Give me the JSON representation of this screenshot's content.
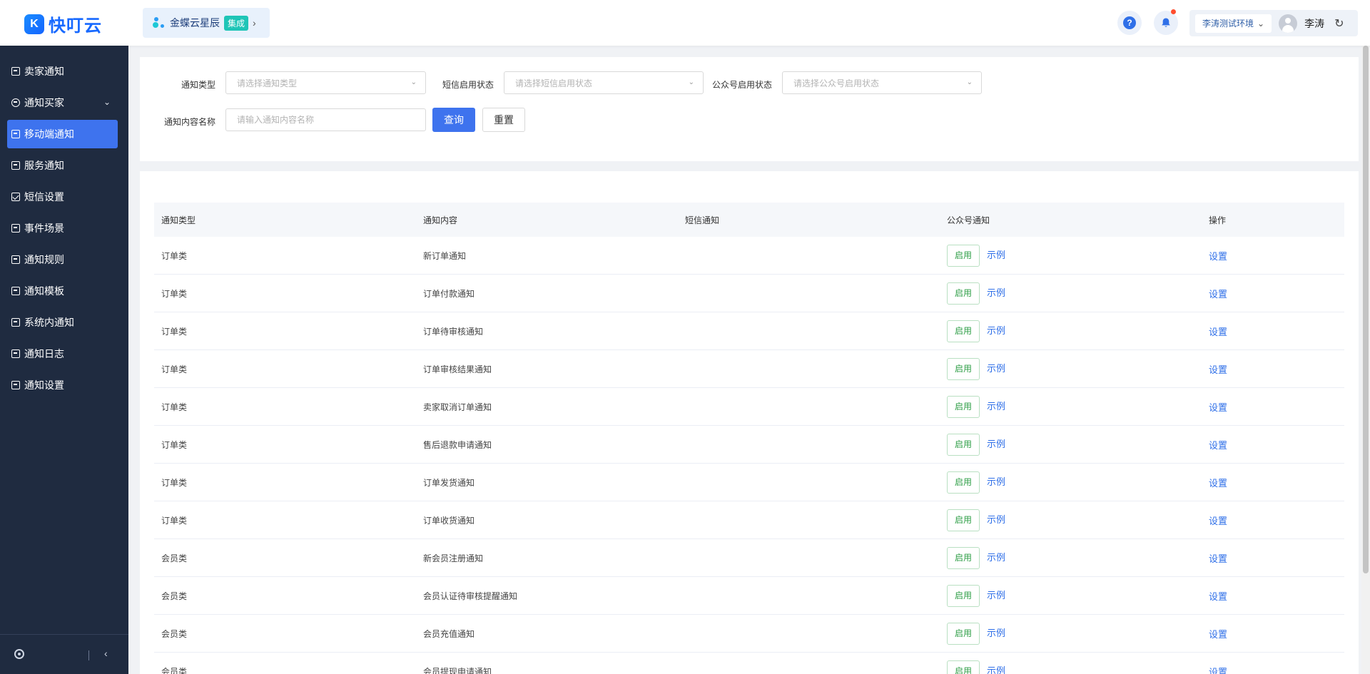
{
  "header": {
    "brand_name": "快叮云",
    "brand_logo": "K",
    "app_name": "金蝶云星辰",
    "app_badge": "集成",
    "app_chevron": "›",
    "help_label": "?",
    "env_name": "李涛测试环境",
    "user_name": "李涛",
    "refresh_glyph": "↻",
    "chevron_glyph": "⌄"
  },
  "sidebar": {
    "items": [
      {
        "label": "卖家通知",
        "icon": "doc-icon"
      },
      {
        "label": "通知买家",
        "icon": "chat-icon",
        "has_submenu": true
      },
      {
        "label": "移动端通知",
        "icon": "doc-icon",
        "active": true
      },
      {
        "label": "服务通知",
        "icon": "doc-icon"
      },
      {
        "label": "短信设置",
        "icon": "mail-icon"
      },
      {
        "label": "事件场景",
        "icon": "doc-icon"
      },
      {
        "label": "通知规则",
        "icon": "doc-icon"
      },
      {
        "label": "通知模板",
        "icon": "doc-icon"
      },
      {
        "label": "系统内通知",
        "icon": "doc-icon"
      },
      {
        "label": "通知日志",
        "icon": "doc-icon"
      },
      {
        "label": "通知设置",
        "icon": "doc-icon"
      }
    ],
    "submenu_chevron": "⌄",
    "collapse_glyph": "‹"
  },
  "filters": {
    "notify_type_label": "通知类型",
    "notify_type_placeholder": "请选择通知类型",
    "sms_status_label": "短信启用状态",
    "sms_status_placeholder": "请选择短信启用状态",
    "mp_status_label": "公众号启用状态",
    "mp_status_placeholder": "请选择公众号启用状态",
    "content_name_label": "通知内容名称",
    "content_name_placeholder": "请输入通知内容名称",
    "content_name_value": "",
    "query_label": "查询",
    "reset_label": "重置",
    "select_chevron": "⌄"
  },
  "table": {
    "columns": [
      "通知类型",
      "通知内容",
      "短信通知",
      "公众号通知",
      "操作"
    ],
    "enable_label": "启用",
    "example_label": "示例",
    "setting_label": "设置",
    "rows": [
      {
        "type": "订单类",
        "content": "新订单通知"
      },
      {
        "type": "订单类",
        "content": "订单付款通知"
      },
      {
        "type": "订单类",
        "content": "订单待审核通知"
      },
      {
        "type": "订单类",
        "content": "订单审核结果通知"
      },
      {
        "type": "订单类",
        "content": "卖家取消订单通知"
      },
      {
        "type": "订单类",
        "content": "售后退款申请通知"
      },
      {
        "type": "订单类",
        "content": "订单发货通知"
      },
      {
        "type": "订单类",
        "content": "订单收货通知"
      },
      {
        "type": "会员类",
        "content": "新会员注册通知"
      },
      {
        "type": "会员类",
        "content": "会员认证待审核提醒通知"
      },
      {
        "type": "会员类",
        "content": "会员充值通知"
      },
      {
        "type": "会员类",
        "content": "会员提现申请通知"
      }
    ]
  },
  "colors": {
    "accent": "#3e73ee",
    "sidebar_bg": "#1f2b40",
    "enable_green": "#2e9e46",
    "link_blue": "#2f6fe8"
  }
}
